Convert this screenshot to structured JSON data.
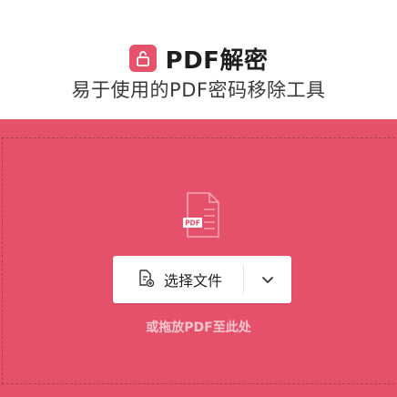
{
  "header": {
    "title": "PDF解密",
    "subtitle": "易于使用的PDF密码移除工具",
    "logo_icon": "unlock-icon"
  },
  "dropzone": {
    "file_icon": "pdf-file-icon",
    "file_icon_tag": "PDF",
    "select_button_label": "选择文件",
    "select_button_icon": "file-add-icon",
    "dropdown_icon": "chevron-down-icon",
    "drop_hint": "或拖放PDF至此处"
  },
  "colors": {
    "accent": "#e5516a",
    "hint_text": "#f7c5cd"
  }
}
